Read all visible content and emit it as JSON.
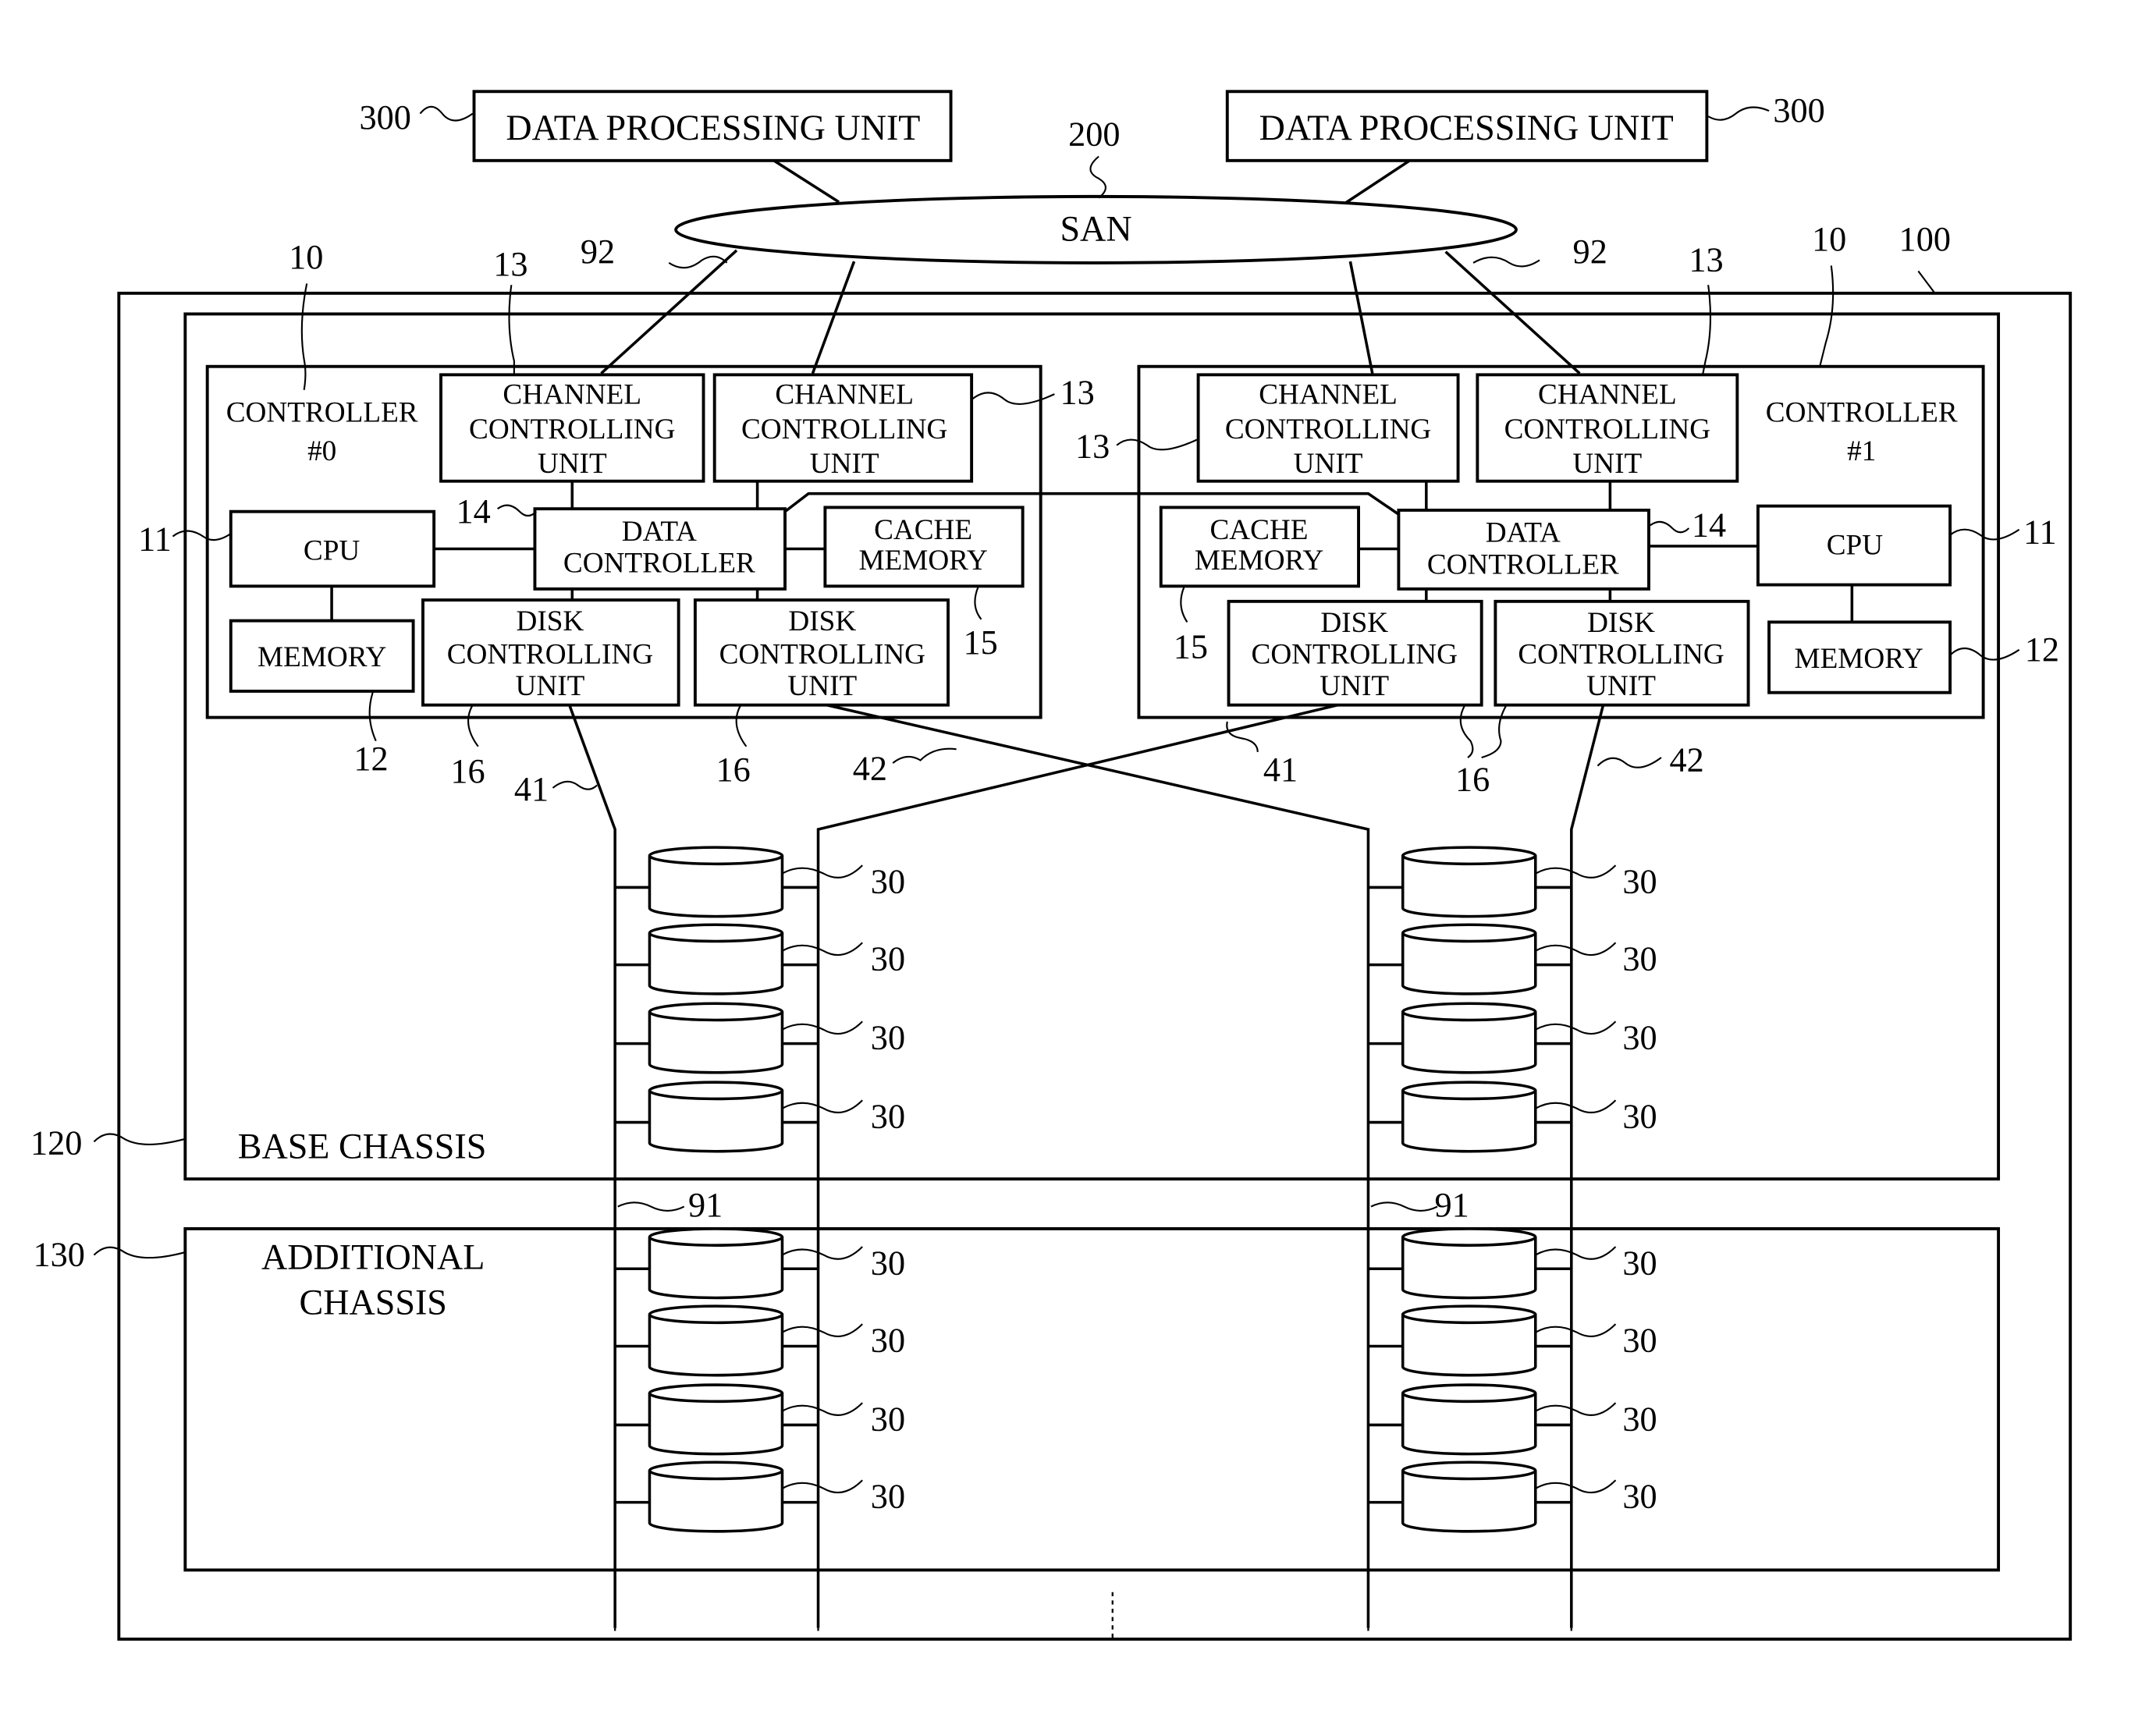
{
  "figure": {
    "data_processing_units": [
      {
        "label": "DATA PROCESSING UNIT",
        "ref": "300"
      },
      {
        "label": "DATA PROCESSING UNIT",
        "ref": "300"
      }
    ],
    "san": {
      "label": "SAN",
      "ref": "200"
    },
    "storage_system_ref": "100",
    "san_link_ref": "92",
    "controllers": [
      {
        "name": "CONTROLLER",
        "number": "#0",
        "ref": "10",
        "channel_units": [
          [
            "CHANNEL",
            "CONTROLLING",
            "UNIT"
          ],
          [
            "CHANNEL",
            "CONTROLLING",
            "UNIT"
          ]
        ],
        "channel_ref": "13",
        "cpu": "CPU",
        "cpu_ref": "11",
        "memory": "MEMORY",
        "memory_ref": "12",
        "data_controller": [
          "DATA",
          "CONTROLLER"
        ],
        "data_controller_ref": "14",
        "cache": [
          "CACHE",
          "MEMORY"
        ],
        "cache_ref": "15",
        "disk_units": [
          [
            "DISK",
            "CONTROLLING",
            "UNIT"
          ],
          [
            "DISK",
            "CONTROLLING",
            "UNIT"
          ]
        ],
        "disk_unit_ref": "16",
        "path_refs": [
          "41",
          "42"
        ]
      },
      {
        "name": "CONTROLLER",
        "number": "#1",
        "ref": "10",
        "channel_units": [
          [
            "CHANNEL",
            "CONTROLLING",
            "UNIT"
          ],
          [
            "CHANNEL",
            "CONTROLLING",
            "UNIT"
          ]
        ],
        "channel_ref": "13",
        "cpu": "CPU",
        "cpu_ref": "11",
        "memory": "MEMORY",
        "memory_ref": "12",
        "data_controller": [
          "DATA",
          "CONTROLLER"
        ],
        "data_controller_ref": "14",
        "cache": [
          "CACHE",
          "MEMORY"
        ],
        "cache_ref": "15",
        "disk_units": [
          [
            "DISK",
            "CONTROLLING",
            "UNIT"
          ],
          [
            "DISK",
            "CONTROLLING",
            "UNIT"
          ]
        ],
        "disk_unit_ref": "16",
        "path_refs": [
          "41",
          "42"
        ]
      }
    ],
    "base_chassis": {
      "label": "BASE CHASSIS",
      "ref": "120"
    },
    "additional_chassis": {
      "label_line1": "ADDITIONAL",
      "label_line2": "CHASSIS",
      "ref": "130"
    },
    "disk_ref": "30",
    "backend_ref": "91"
  }
}
